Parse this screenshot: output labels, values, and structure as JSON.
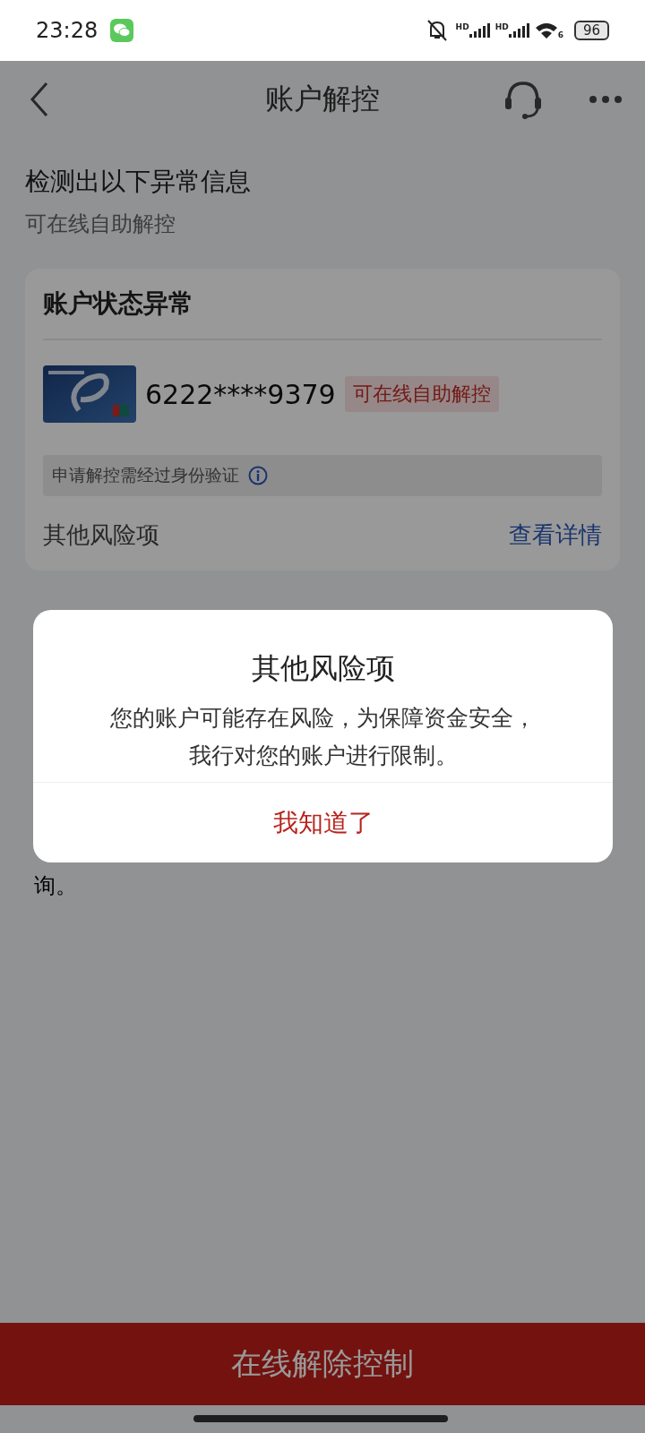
{
  "status_bar": {
    "time": "23:28",
    "signal_labels": [
      "HD",
      "HD"
    ],
    "wifi_label": "6",
    "battery": "96"
  },
  "nav": {
    "title": "账户解控"
  },
  "header": {
    "title": "检测出以下异常信息",
    "subtitle": "可在线自助解控"
  },
  "card": {
    "title": "账户状态异常",
    "account": {
      "number": "6222****9379",
      "badge": "可在线自助解控"
    },
    "notice": "申请解控需经过身份验证",
    "risk": {
      "label": "其他风险项",
      "link": "查看详情"
    }
  },
  "hidden_text": "询。",
  "dialog": {
    "title": "其他风险项",
    "message_lines": [
      "您的账户可能存在风险，为保障资金安全，",
      "我行对您的账户进行限制。"
    ],
    "button": "我知道了"
  },
  "bottom_button": "在线解除控制"
}
